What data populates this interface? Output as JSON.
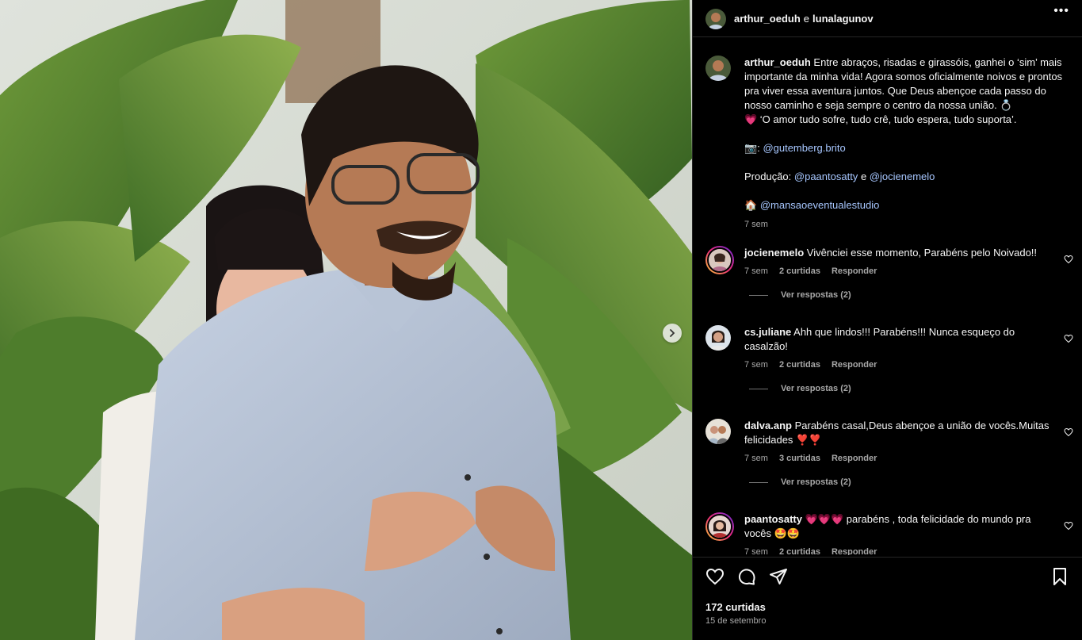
{
  "header": {
    "user1": "arthur_oeduh",
    "conj": "e",
    "user2": "lunalagunov",
    "more_icon": "more-horizontal-icon"
  },
  "caption": {
    "username": "arthur_oeduh",
    "text": "Entre abraços, risadas e girassóis, ganhei o ‘sim’ mais importante da minha vida! Agora somos oficialmente noivos e prontos pra viver essa aventura juntos. Que Deus abençoe cada passo do nosso caminho e seja sempre o centro da nossa união. 💍",
    "quote": "💗 ‘O amor tudo sofre, tudo crê, tudo espera, tudo suporta’.",
    "camera_emoji": "📷:",
    "photographer": "@gutemberg.brito",
    "production_label": "Produção:",
    "producer1": "@paantosatty",
    "producer_conj": "e",
    "producer2": "@jocienemelo",
    "house_emoji": "🏠",
    "venue": "@mansaoeventualestudio",
    "time": "7 sem"
  },
  "comments": [
    {
      "username": "jocienemelo",
      "text": "Vivênciei esse momento, Parabéns pelo Noivado!!",
      "time": "7 sem",
      "likes": "2 curtidas",
      "reply": "Responder",
      "replies": "Ver respostas (2)"
    },
    {
      "username": "cs.juliane",
      "text": "Ahh que lindos!!! Parabéns!!! Nunca esqueço do casalzão!",
      "time": "7 sem",
      "likes": "2 curtidas",
      "reply": "Responder",
      "replies": "Ver respostas (2)"
    },
    {
      "username": "dalva.anp",
      "text": "Parabéns casal,Deus abençoe a união de vocês.Muitas felicidades ❣️❣️",
      "time": "7 sem",
      "likes": "3 curtidas",
      "reply": "Responder",
      "replies": "Ver respostas (2)"
    },
    {
      "username": "paantosatty",
      "text": "💗💗💗 parabéns , toda felicidade do mundo pra vocês 🤩🤩",
      "time": "7 sem",
      "likes": "2 curtidas",
      "reply": "Responder",
      "replies": ""
    }
  ],
  "footer": {
    "likes": "172 curtidas",
    "date": "15 de setembro"
  },
  "icons": [
    "heart-icon",
    "comment-icon",
    "share-icon",
    "bookmark-icon",
    "chevron-right-icon"
  ]
}
